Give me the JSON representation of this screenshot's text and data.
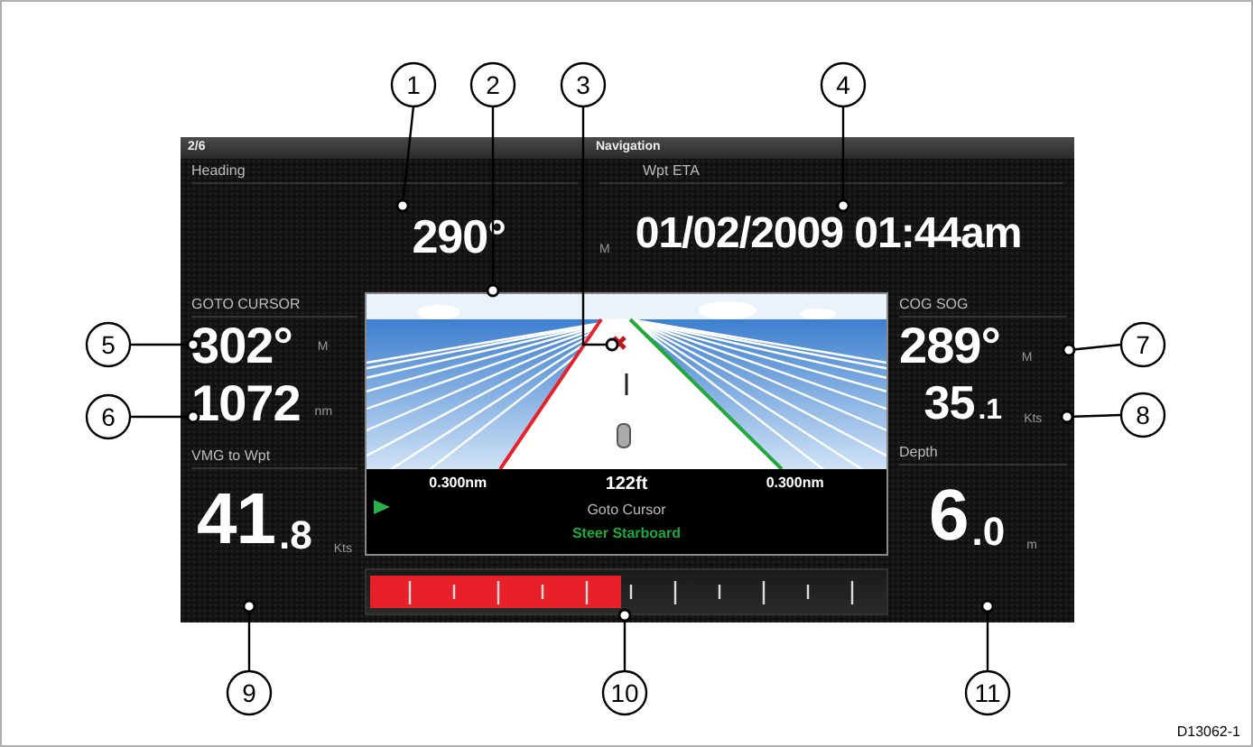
{
  "header": {
    "page": "2/6",
    "title": "Navigation"
  },
  "heading": {
    "label": "Heading",
    "value": "290°",
    "unit": "M"
  },
  "wpt_eta": {
    "label": "Wpt ETA",
    "value": "01/02/2009 01:44am"
  },
  "goto_cursor": {
    "label": "GOTO CURSOR",
    "bearing": {
      "value": "302°",
      "unit": "M"
    },
    "distance": {
      "value": "1072",
      "unit": "nm"
    }
  },
  "vmg": {
    "label": "VMG to Wpt",
    "value": "41",
    "fraction": ".8",
    "unit": "Kts"
  },
  "highway": {
    "left_distance": "0.300nm",
    "center_distance": "122ft",
    "right_distance": "0.300nm",
    "mode": "Goto Cursor",
    "steer": "Steer Starboard"
  },
  "xte_bar": {
    "level": 0.49
  },
  "cog_sog": {
    "label": "COG SOG",
    "cog": {
      "value": "289°",
      "unit": "M"
    },
    "sog": {
      "value": "35",
      "fraction": ".1",
      "unit": "Kts"
    }
  },
  "depth": {
    "label": "Depth",
    "value": "6",
    "fraction": ".0",
    "unit": "m"
  },
  "callouts": [
    "1",
    "2",
    "3",
    "4",
    "5",
    "6",
    "7",
    "8",
    "9",
    "10",
    "11"
  ],
  "figure_id": "D13062-1"
}
